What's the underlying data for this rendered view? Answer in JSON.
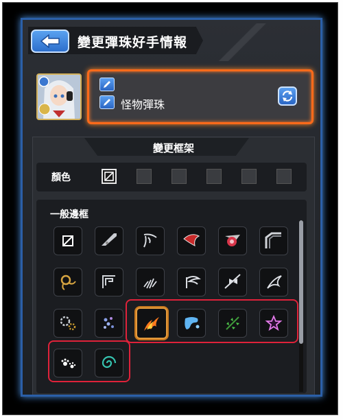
{
  "header": {
    "title": "變更彈珠好手情報"
  },
  "profile": {
    "monster_name": "怪物彈珠"
  },
  "frame_section": {
    "title": "變更框架",
    "color_label": "顏色",
    "list_label": "一般邊框"
  }
}
